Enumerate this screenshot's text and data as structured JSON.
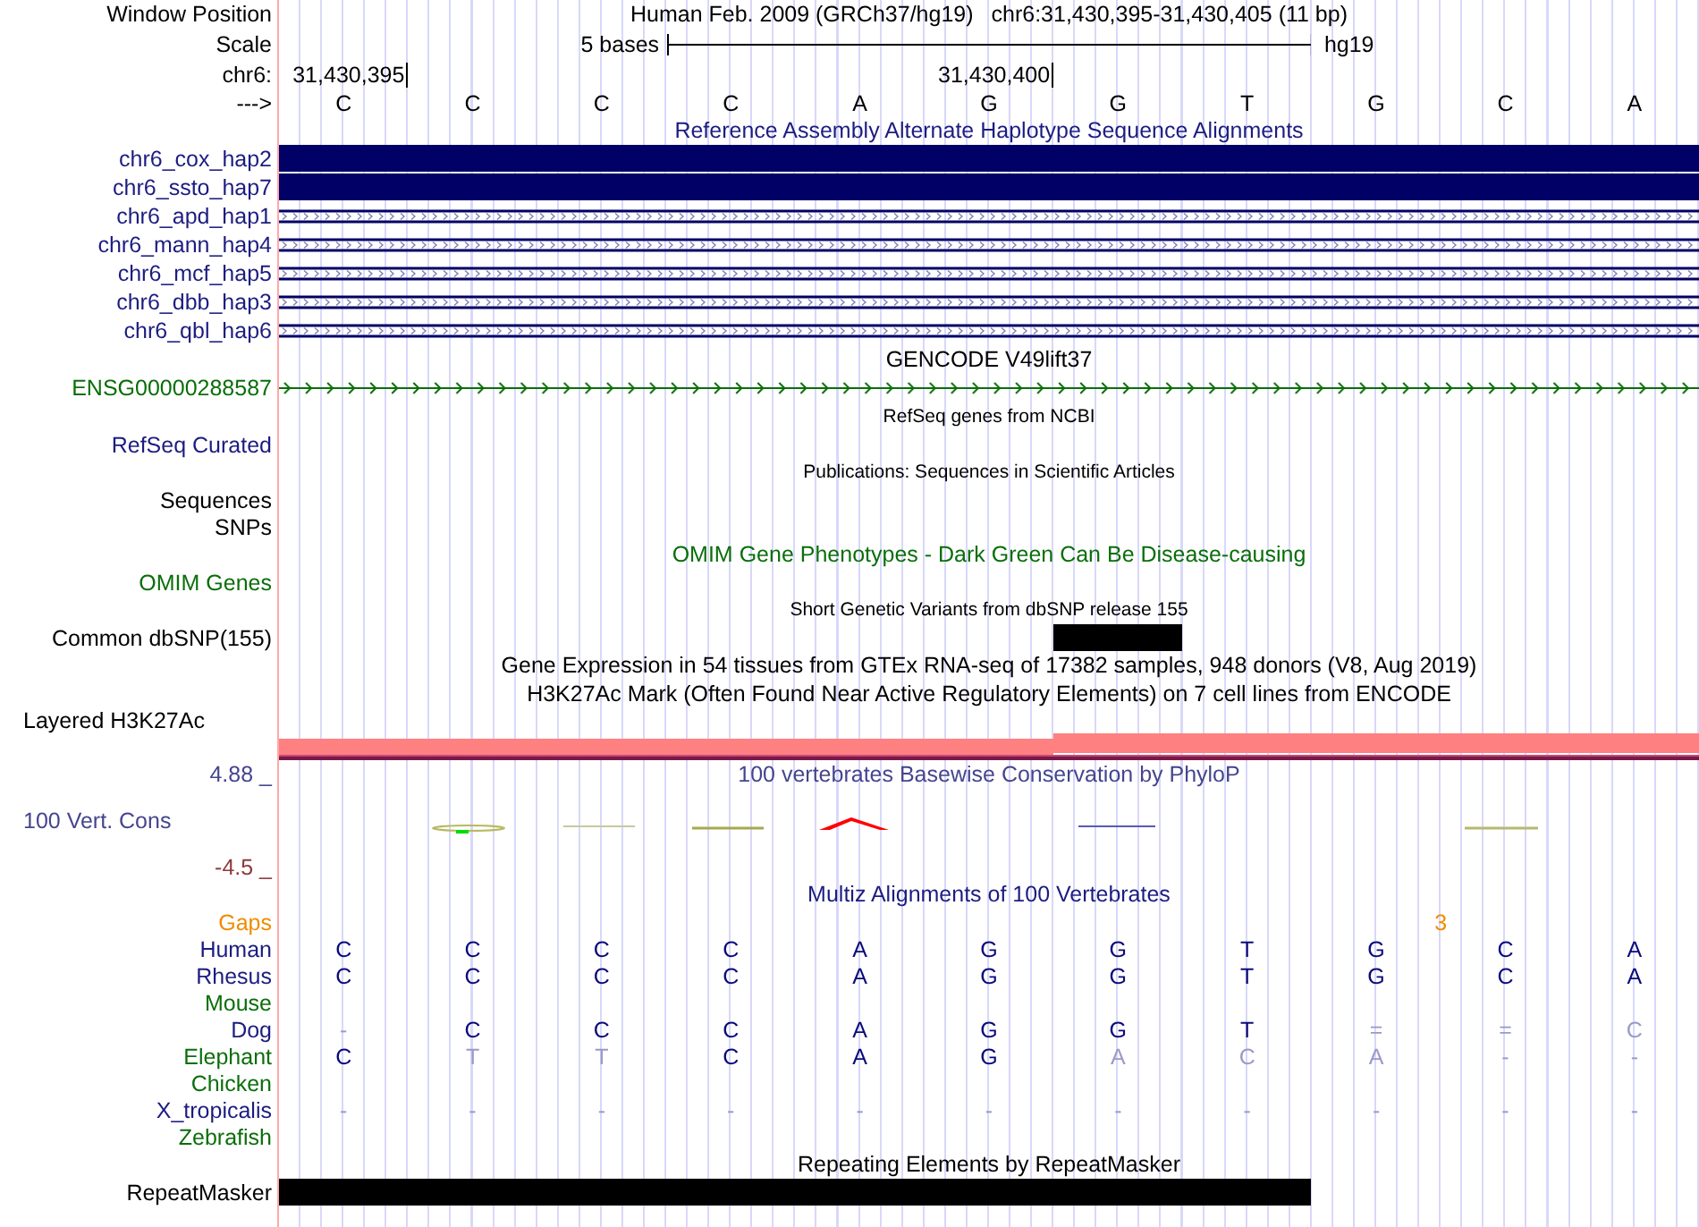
{
  "position": {
    "label": "Window Position",
    "assembly": "Human Feb. 2009 (GRCh37/hg19)",
    "range": "chr6:31,430,395-31,430,405 (11 bp)"
  },
  "scale": {
    "label": "Scale",
    "length": "5 bases",
    "db": "hg19"
  },
  "ruler": {
    "label": "chr6:",
    "ticks": [
      {
        "text": "31,430,395"
      },
      {
        "text": "31,430,400"
      }
    ]
  },
  "sequence": {
    "label": "--->",
    "bases": [
      "C",
      "C",
      "C",
      "C",
      "A",
      "G",
      "G",
      "T",
      "G",
      "C",
      "A"
    ]
  },
  "tracks": [
    {
      "kind": "title",
      "text": "Reference Assembly Alternate Haplotype Sequence Alignments",
      "color": "#1c1c80"
    },
    {
      "kind": "alignment",
      "label": "chr6_cox_hap2",
      "solid": true,
      "color": "#1c1c80"
    },
    {
      "kind": "alignment",
      "label": "chr6_ssto_hap7",
      "solid": true,
      "color": "#1c1c80"
    },
    {
      "kind": "alignment",
      "label": "chr6_apd_hap1",
      "solid": false,
      "color": "#1c1c80"
    },
    {
      "kind": "alignment",
      "label": "chr6_mann_hap4",
      "solid": false,
      "color": "#1c1c80"
    },
    {
      "kind": "alignment",
      "label": "chr6_mcf_hap5",
      "solid": false,
      "color": "#1c1c80"
    },
    {
      "kind": "alignment",
      "label": "chr6_dbb_hap3",
      "solid": false,
      "color": "#1c1c80"
    },
    {
      "kind": "alignment",
      "label": "chr6_qbl_hap6",
      "solid": false,
      "color": "#1c1c80"
    },
    {
      "kind": "title",
      "text": "GENCODE V49lift37",
      "color": "#000000"
    },
    {
      "kind": "gene",
      "label": "ENSG00000288587",
      "color": "#0a6e0a"
    },
    {
      "kind": "title",
      "text": "RefSeq genes from NCBI",
      "small": true,
      "color": "#000000"
    },
    {
      "kind": "label",
      "label": "RefSeq Curated",
      "color": "#1c1c80"
    },
    {
      "kind": "title",
      "text": "Publications: Sequences in Scientific Articles",
      "small": true,
      "color": "#000000"
    },
    {
      "kind": "label",
      "label": "Sequences",
      "color": "#000000"
    },
    {
      "kind": "label",
      "label": "SNPs",
      "color": "#000000"
    },
    {
      "kind": "title",
      "text": "OMIM Gene Phenotypes - Dark Green Can Be Disease-causing",
      "color": "#0a6e0a"
    },
    {
      "kind": "label",
      "label": "OMIM Genes",
      "color": "#0a6e0a"
    },
    {
      "kind": "title",
      "text": "Short Genetic Variants from dbSNP release 155",
      "small": true,
      "color": "#000000"
    },
    {
      "kind": "coverage",
      "label": "Common dbSNP(155)",
      "color": "#000000",
      "covered": [
        false,
        false,
        false,
        false,
        false,
        false,
        true,
        false,
        false,
        false,
        false
      ]
    },
    {
      "kind": "title",
      "text": "Gene Expression in 54 tissues from GTEx RNA-seq of 17382 samples, 948 donors (V8, Aug 2019)",
      "color": "#000000"
    },
    {
      "kind": "title",
      "text": "H3K27Ac Mark (Often Found Near Active Regulatory Elements) on 7 cell lines from ENCODE",
      "color": "#000000"
    },
    {
      "kind": "layered",
      "label": "Layered H3K27Ac",
      "color": "#000000"
    },
    {
      "kind": "wiggle",
      "title": "100 vertebrates Basewise Conservation by PhyloP",
      "label": "100 Vert. Cons",
      "max": "4.88 _",
      "min": "-4.5 _",
      "color": "#45458f"
    },
    {
      "kind": "title",
      "text": "Multiz Alignments of 100 Vertebrates",
      "color": "#1c1c80"
    },
    {
      "kind": "gaps",
      "label": "Gaps",
      "count": "3",
      "color": "#f08c00"
    },
    {
      "kind": "species",
      "label": "Human",
      "color": "#1c1c80",
      "bases": [
        {
          "text": "C",
          "faded": false
        },
        {
          "text": "C",
          "faded": false
        },
        {
          "text": "C",
          "faded": false
        },
        {
          "text": "C",
          "faded": false
        },
        {
          "text": "A",
          "faded": false
        },
        {
          "text": "G",
          "faded": false
        },
        {
          "text": "G",
          "faded": false
        },
        {
          "text": "T",
          "faded": false
        },
        {
          "text": "G",
          "faded": false
        },
        {
          "text": "C",
          "faded": false
        },
        {
          "text": "A",
          "faded": false
        }
      ]
    },
    {
      "kind": "species",
      "label": "Rhesus",
      "color": "#1c1c80",
      "bases": [
        {
          "text": "C",
          "faded": false
        },
        {
          "text": "C",
          "faded": false
        },
        {
          "text": "C",
          "faded": false
        },
        {
          "text": "C",
          "faded": false
        },
        {
          "text": "A",
          "faded": false
        },
        {
          "text": "G",
          "faded": false
        },
        {
          "text": "G",
          "faded": false
        },
        {
          "text": "T",
          "faded": false
        },
        {
          "text": "G",
          "faded": false
        },
        {
          "text": "C",
          "faded": false
        },
        {
          "text": "A",
          "faded": false
        }
      ]
    },
    {
      "kind": "species",
      "label": "Mouse",
      "color": "#0a6e0a"
    },
    {
      "kind": "species",
      "label": "Dog",
      "color": "#1c1c80",
      "bases": [
        {
          "text": "-",
          "faded": true
        },
        {
          "text": "C",
          "faded": false
        },
        {
          "text": "C",
          "faded": false
        },
        {
          "text": "C",
          "faded": false
        },
        {
          "text": "A",
          "faded": false
        },
        {
          "text": "G",
          "faded": false
        },
        {
          "text": "G",
          "faded": false
        },
        {
          "text": "T",
          "faded": false
        },
        {
          "text": "=",
          "faded": true
        },
        {
          "text": "=",
          "faded": true
        },
        {
          "text": "C",
          "faded": true
        }
      ]
    },
    {
      "kind": "species",
      "label": "Elephant",
      "color": "#0a6e0a",
      "bases": [
        {
          "text": "C",
          "faded": false
        },
        {
          "text": "T",
          "faded": true
        },
        {
          "text": "T",
          "faded": true
        },
        {
          "text": "C",
          "faded": false
        },
        {
          "text": "A",
          "faded": false
        },
        {
          "text": "G",
          "faded": false
        },
        {
          "text": "A",
          "faded": true
        },
        {
          "text": "C",
          "faded": true
        },
        {
          "text": "A",
          "faded": true
        },
        {
          "text": "-",
          "faded": true
        },
        {
          "text": "-",
          "faded": true
        }
      ]
    },
    {
      "kind": "species",
      "label": "Chicken",
      "color": "#0a6e0a"
    },
    {
      "kind": "species",
      "label": "X_tropicalis",
      "color": "#1c1c80",
      "bases": [
        {
          "text": "-",
          "faded": true
        },
        {
          "text": "-",
          "faded": true
        },
        {
          "text": "-",
          "faded": true
        },
        {
          "text": "-",
          "faded": true
        },
        {
          "text": "-",
          "faded": true
        },
        {
          "text": "-",
          "faded": true
        },
        {
          "text": "-",
          "faded": true
        },
        {
          "text": "-",
          "faded": true
        },
        {
          "text": "-",
          "faded": true
        },
        {
          "text": "-",
          "faded": true
        },
        {
          "text": "-",
          "faded": true
        }
      ]
    },
    {
      "kind": "species",
      "label": "Zebrafish",
      "color": "#0a6e0a"
    },
    {
      "kind": "title",
      "text": "Repeating Elements by RepeatMasker",
      "color": "#000000"
    },
    {
      "kind": "coverage",
      "label": "RepeatMasker",
      "color": "#000000",
      "covered": [
        true,
        true,
        true,
        true,
        true,
        true,
        true,
        true,
        false,
        false,
        false
      ]
    }
  ]
}
